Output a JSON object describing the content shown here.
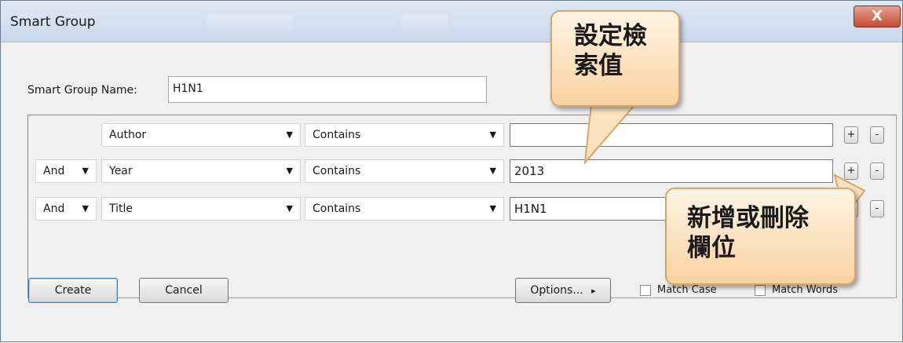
{
  "window": {
    "title": "Smart Group",
    "close_label": "X",
    "bg_field_text": "Contains"
  },
  "name_row": {
    "label": "Smart Group Name:",
    "value": "H1N1"
  },
  "rows": [
    {
      "connector": "",
      "field": "Author",
      "operator": "Contains",
      "value": ""
    },
    {
      "connector": "And",
      "field": "Year",
      "operator": "Contains",
      "value": "2013"
    },
    {
      "connector": "And",
      "field": "Title",
      "operator": "Contains",
      "value": "H1N1"
    }
  ],
  "row_buttons": {
    "add": "+",
    "remove": "-"
  },
  "buttons": {
    "create": "Create",
    "cancel": "Cancel",
    "options": "Options...",
    "options_arrow": "▸"
  },
  "checkboxes": {
    "match_case": "Match Case",
    "match_words": "Match Words"
  },
  "callouts": {
    "search_value": {
      "line1": "設定檢",
      "line2": "索值"
    },
    "add_remove": {
      "line1": "新增或刪除",
      "line2": "欄位"
    }
  }
}
